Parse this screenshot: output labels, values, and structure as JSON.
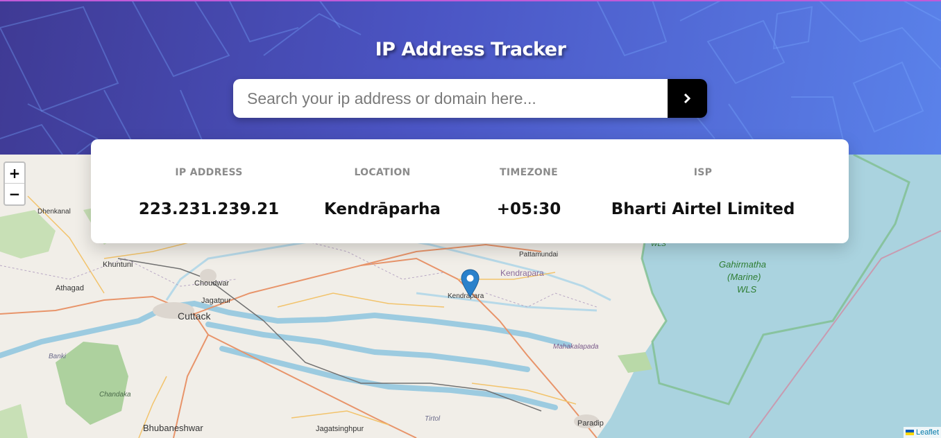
{
  "header": {
    "title": "IP Address Tracker",
    "search_placeholder": "Search your ip address or domain here...",
    "submit_icon": "chevron-right-icon"
  },
  "info": {
    "ip": {
      "label": "IP ADDRESS",
      "value": "223.231.239.21"
    },
    "location": {
      "label": "LOCATION",
      "value": "Kendrāparha"
    },
    "timezone": {
      "label": "TIMEZONE",
      "value": "+05:30"
    },
    "isp": {
      "label": "ISP",
      "value": "Bharti Airtel Limited"
    }
  },
  "map": {
    "zoom_in": "+",
    "zoom_out": "−",
    "attribution": "Leaflet",
    "marker_icon": "map-pin-icon",
    "labels": {
      "dhenkanal": "Dhenkanal",
      "khuntuni": "Khuntuni",
      "choudwar": "Choudwar",
      "athagad": "Athagad",
      "jagatpur": "Jagatpur",
      "cuttack": "Cuttack",
      "banki": "Banki",
      "chandaka": "Chandaka",
      "bhubaneshwar": "Bhubaneshwar",
      "jagatsinghpur": "Jagatsinghpur",
      "tirtol": "Tirtol",
      "paradip": "Paradip",
      "mahakalapada": "Mahakalapada",
      "pattamundai": "Pattamundai",
      "kendrapara_district": "Kendrapara",
      "kendrapara_town": "Kendrapara",
      "wls_top": "WLS",
      "gahirmatha_1": "Gahirmatha",
      "gahirmatha_2": "(Marine)",
      "gahirmatha_3": "WLS"
    }
  },
  "colors": {
    "header_start": "#3f3a94",
    "header_end": "#5a82ea",
    "sea": "#aad3df",
    "land": "#f1eee8",
    "forest": "#add19e",
    "marker": "#2a81cb"
  }
}
